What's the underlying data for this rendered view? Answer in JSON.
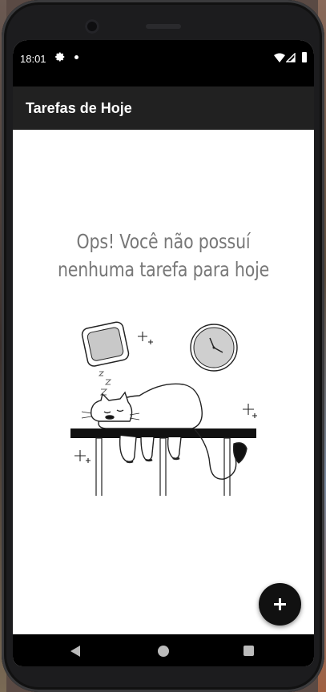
{
  "status_bar": {
    "time": "18:01",
    "icons": [
      "gear-icon",
      "notification-dot-icon",
      "wifi-icon",
      "signal-icon",
      "battery-icon"
    ]
  },
  "app_bar": {
    "title": "Tarefas de Hoje",
    "background": "#212121"
  },
  "empty_state": {
    "message": "Ops! Você não possuí nenhuma tarefa para hoje",
    "illustration": "sleeping-cat-illustration",
    "text_color": "#777777"
  },
  "fab": {
    "icon": "plus-icon",
    "color": "#111111"
  },
  "nav_bar": {
    "buttons": [
      "back-icon",
      "home-icon",
      "recents-icon"
    ]
  }
}
